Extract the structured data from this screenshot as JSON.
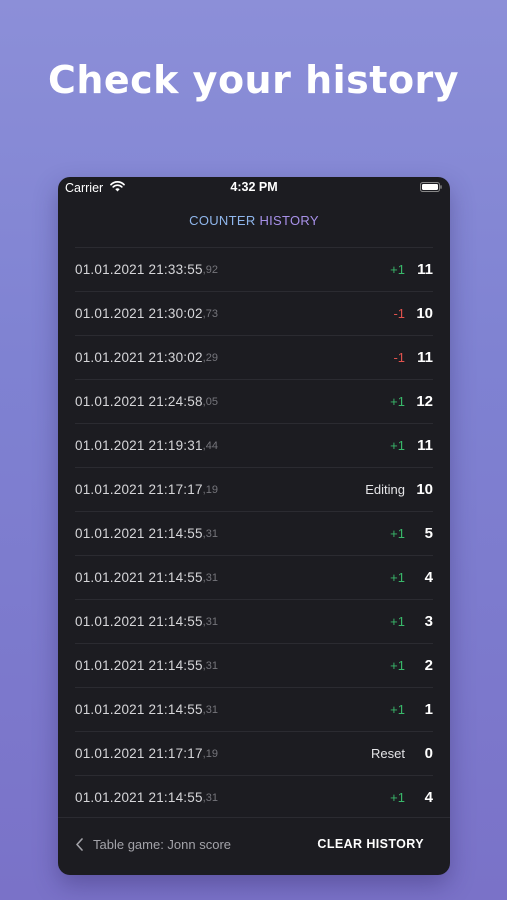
{
  "headline": "Check your history",
  "status_bar": {
    "carrier": "Carrier",
    "time": "4:32 PM"
  },
  "nav": {
    "title_part1": "COUNTER ",
    "title_part2": "HISTORY"
  },
  "colors": {
    "positive": "#39b86a",
    "negative": "#e0524d",
    "neutral": "#e4e4e7",
    "title_blue": "#8fb6ec",
    "title_purple": "#a790e8"
  },
  "history": [
    {
      "timestamp": "01.01.2021 21:33:55",
      "ms": ",92",
      "delta": "+1",
      "kind": "positive",
      "value": "11"
    },
    {
      "timestamp": "01.01.2021 21:30:02",
      "ms": ",73",
      "delta": "-1",
      "kind": "negative",
      "value": "10"
    },
    {
      "timestamp": "01.01.2021 21:30:02",
      "ms": ",29",
      "delta": "-1",
      "kind": "negative",
      "value": "11"
    },
    {
      "timestamp": "01.01.2021 21:24:58",
      "ms": ",05",
      "delta": "+1",
      "kind": "positive",
      "value": "12"
    },
    {
      "timestamp": "01.01.2021 21:19:31",
      "ms": ",44",
      "delta": "+1",
      "kind": "positive",
      "value": "11"
    },
    {
      "timestamp": "01.01.2021 21:17:17",
      "ms": ",19",
      "delta": "Editing",
      "kind": "neutral",
      "value": "10"
    },
    {
      "timestamp": "01.01.2021 21:14:55",
      "ms": ",31",
      "delta": "+1",
      "kind": "positive",
      "value": "5"
    },
    {
      "timestamp": "01.01.2021 21:14:55",
      "ms": ",31",
      "delta": "+1",
      "kind": "positive",
      "value": "4"
    },
    {
      "timestamp": "01.01.2021 21:14:55",
      "ms": ",31",
      "delta": "+1",
      "kind": "positive",
      "value": "3"
    },
    {
      "timestamp": "01.01.2021 21:14:55",
      "ms": ",31",
      "delta": "+1",
      "kind": "positive",
      "value": "2"
    },
    {
      "timestamp": "01.01.2021 21:14:55",
      "ms": ",31",
      "delta": "+1",
      "kind": "positive",
      "value": "1"
    },
    {
      "timestamp": "01.01.2021 21:17:17",
      "ms": ",19",
      "delta": "Reset",
      "kind": "neutral",
      "value": "0"
    },
    {
      "timestamp": "01.01.2021 21:14:55",
      "ms": ",31",
      "delta": "+1",
      "kind": "positive",
      "value": "4"
    }
  ],
  "footer": {
    "back_label": "Table game: Jonn score",
    "clear_label": "CLEAR HISTORY"
  },
  "icons": {
    "wifi": "wifi-icon",
    "battery": "battery-icon",
    "back": "chevron-left-icon"
  }
}
